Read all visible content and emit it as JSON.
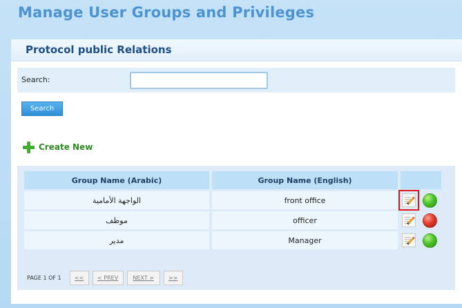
{
  "page": {
    "title": "Manage User Groups and Privileges"
  },
  "panel": {
    "title": "Protocol public Relations"
  },
  "search": {
    "label": "Search:",
    "value": "",
    "placeholder": "",
    "button_label": "Search"
  },
  "create_new": {
    "label": "Create New"
  },
  "table": {
    "headers": [
      "Group Name (Arabic)",
      "Group Name (English)",
      ""
    ],
    "rows": [
      {
        "arabic": "الواجهة الأمامية",
        "english": "front office",
        "status": "active"
      },
      {
        "arabic": "موظف",
        "english": "officer",
        "status": "inactive"
      },
      {
        "arabic": "مدير",
        "english": "Manager",
        "status": "active"
      }
    ]
  },
  "pager": {
    "text": "PAGE 1 OF 1",
    "first": "<<",
    "prev": "< PREV",
    "next": "NEXT >",
    "last": ">>"
  },
  "colors": {
    "title": "#4d93d1",
    "status_active": "#4bc52a",
    "status_inactive": "#e23b2d",
    "highlight": "#e0141a"
  },
  "icons": {
    "create": "plus-icon",
    "edit": "edit-icon",
    "status": "status-dot"
  }
}
